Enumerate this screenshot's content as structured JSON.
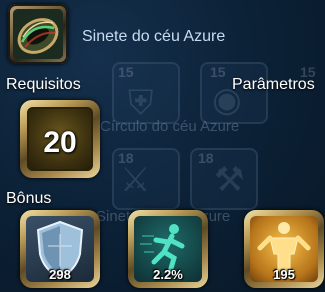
{
  "item": {
    "name": "Sinete do céu Azure",
    "icon": "ring-icon"
  },
  "labels": {
    "requirements": "Requisitos",
    "parameters": "Parâmetros",
    "bonus": "Bônus"
  },
  "requirement": {
    "level": "20",
    "icon": "level-badge"
  },
  "bonuses": [
    {
      "icon": "shield-icon",
      "value": "298",
      "color": "#8fb7d6"
    },
    {
      "icon": "running-man-icon",
      "value": "2.2%",
      "color": "#2fc5a8"
    },
    {
      "icon": "body-figure-icon",
      "value": "195",
      "color": "#f0b030"
    }
  ],
  "background": {
    "set_name": "Círculo do céu Azure",
    "set_name_2": "Sinete do céu Azure",
    "levels": [
      "15",
      "15",
      "15",
      "18",
      "18"
    ]
  }
}
